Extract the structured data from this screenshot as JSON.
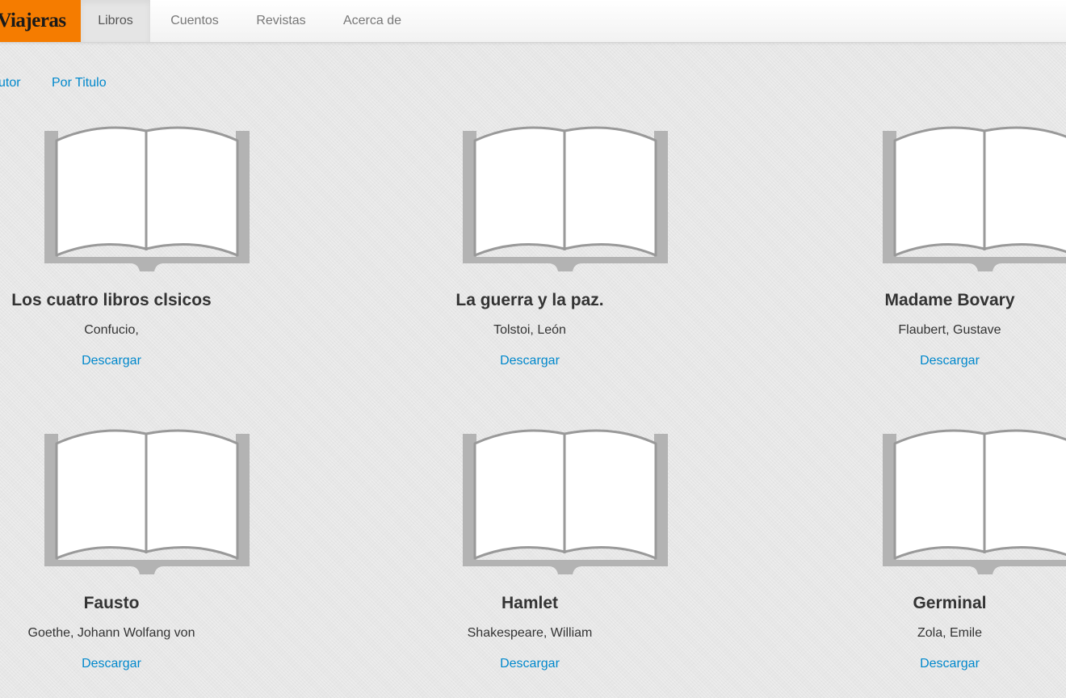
{
  "brand": {
    "name": "Viajeras"
  },
  "nav": {
    "items": [
      {
        "label": "Libros",
        "active": true
      },
      {
        "label": "Cuentos",
        "active": false
      },
      {
        "label": "Revistas",
        "active": false
      },
      {
        "label": "Acerca de",
        "active": false
      }
    ]
  },
  "sort": {
    "by_author": "utor",
    "by_title": "Por Titulo"
  },
  "books": [
    {
      "title": "Los cuatro libros clsicos",
      "author": "Confucio,",
      "download_label": "Descargar",
      "icon": "open-book-icon"
    },
    {
      "title": "La guerra y la paz.",
      "author": "Tolstoi, León",
      "download_label": "Descargar",
      "icon": "open-book-icon"
    },
    {
      "title": "Madame Bovary",
      "author": "Flaubert, Gustave",
      "download_label": "Descargar",
      "icon": "open-book-icon"
    },
    {
      "title": "Fausto",
      "author": "Goethe, Johann Wolfang von",
      "download_label": "Descargar",
      "icon": "open-book-icon"
    },
    {
      "title": "Hamlet",
      "author": "Shakespeare, William",
      "download_label": "Descargar",
      "icon": "open-book-icon"
    },
    {
      "title": "Germinal",
      "author": "Zola, Emile",
      "download_label": "Descargar",
      "icon": "open-book-icon"
    }
  ],
  "colors": {
    "brand_bg": "#f57c00",
    "link": "#0088cc",
    "text": "#333333",
    "book_stroke": "#a8a8a8"
  }
}
